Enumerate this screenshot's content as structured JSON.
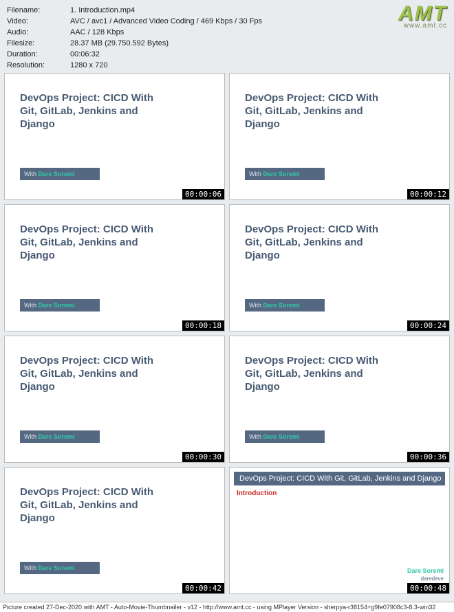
{
  "meta": {
    "filename_label": "Filename:",
    "filename": "1. Introduction.mp4",
    "video_label": "Video:",
    "video": "AVC / avc1 / Advanced Video Coding / 469 Kbps / 30 Fps",
    "audio_label": "Audio:",
    "audio": "AAC / 128 Kbps",
    "filesize_label": "Filesize:",
    "filesize": "28.37 MB (29.750.592 Bytes)",
    "duration_label": "Duration:",
    "duration": "00:06:32",
    "resolution_label": "Resolution:",
    "resolution": "1280 x 720"
  },
  "logo": {
    "text": "AMT",
    "sub": "www.amt.cc"
  },
  "slide": {
    "title": "DevOps Project: CICD With Git, GitLab, Jenkins and Django",
    "with": "With",
    "author": "Dare Soremi"
  },
  "alt_slide": {
    "header": "DevOps Project: CICD With Git, GitLab, Jenkins and Django",
    "intro": "Introduction",
    "credit_name": "Dare Soremi",
    "credit_sub": "daredeve"
  },
  "timestamps": [
    "00:00:06",
    "00:00:12",
    "00:00:18",
    "00:00:24",
    "00:00:30",
    "00:00:36",
    "00:00:42",
    "00:00:48"
  ],
  "footer": "Picture created 27-Dec-2020 with AMT - Auto-Movie-Thumbnailer - v12 - http://www.amt.cc - using MPlayer Version - sherpya-r38154+g9fe07908c3-8.3-win32"
}
